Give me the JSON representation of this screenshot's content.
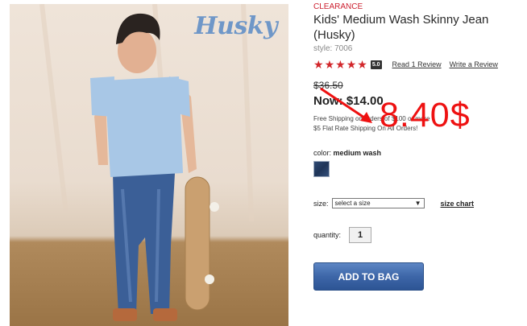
{
  "product": {
    "brand_logo": "Husky",
    "clearance_label": "CLEARANCE",
    "title": "Kids' Medium Wash Skinny Jean (Husky)",
    "style": "style: 7006",
    "rating": {
      "stars": 5,
      "score": "5.0",
      "read_reviews": "Read 1 Review",
      "write_review": "Write a Review"
    },
    "original_price": "$36.50",
    "now_price": "Now: $14.00",
    "shipping_line1": "Free Shipping on orders of $100 or more",
    "shipping_line2": "$5 Flat Rate Shipping On All Orders!",
    "color": {
      "label": "color:",
      "value": "medium wash",
      "swatch_color": "#25406a"
    },
    "size": {
      "label": "size:",
      "selected": "select a size",
      "size_chart": "size chart"
    },
    "quantity": {
      "label": "quantity:",
      "value": "1"
    },
    "add_to_bag": "ADD TO BAG"
  },
  "annotation": {
    "text": "8.40$",
    "color": "#ee1111"
  },
  "colors": {
    "accent_red": "#cc1f2f",
    "button_blue": "#3d66a8"
  }
}
